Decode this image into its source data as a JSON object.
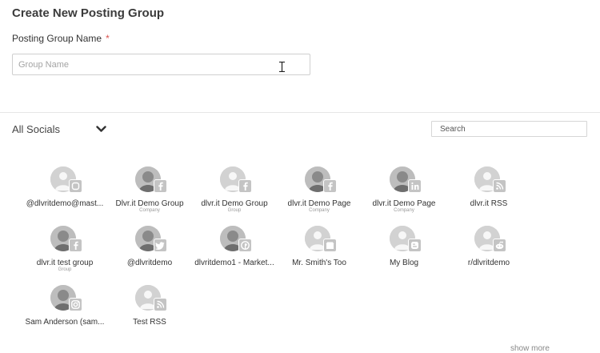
{
  "form": {
    "title": "Create New Posting Group",
    "group_name_label": "Posting Group Name",
    "required_mark": "*",
    "group_name_placeholder": "Group Name",
    "group_name_value": ""
  },
  "socials": {
    "filter_label": "All Socials",
    "search_placeholder": "Search",
    "show_more_label": "show more",
    "accounts": [
      {
        "name": "@dlvritdemo@mast...",
        "sub": "",
        "network": "mastodon-icon",
        "avatar": "default-avatar-icon"
      },
      {
        "name": "Dlvr.it Demo Group",
        "sub": "Company",
        "network": "facebook-icon",
        "avatar": "photo-avatar"
      },
      {
        "name": "dlvr.it Demo Group",
        "sub": "Group",
        "network": "facebook-icon",
        "avatar": "default-avatar-icon"
      },
      {
        "name": "dlvr.it Demo Page",
        "sub": "Company",
        "network": "facebook-icon",
        "avatar": "photo-avatar"
      },
      {
        "name": "dlvr.it Demo Page",
        "sub": "Company",
        "network": "linkedin-icon",
        "avatar": "photo-avatar"
      },
      {
        "name": "dlvr.it RSS",
        "sub": "",
        "network": "rss-icon",
        "avatar": "default-avatar-icon"
      },
      {
        "name": "dlvr.it test group",
        "sub": "Group",
        "network": "facebook-icon",
        "avatar": "photo-avatar"
      },
      {
        "name": "@dlvritdemo",
        "sub": "",
        "network": "twitter-icon",
        "avatar": "photo-avatar"
      },
      {
        "name": "dlvritdemo1 - Market...",
        "sub": "",
        "network": "pinterest-icon",
        "avatar": "photo-avatar"
      },
      {
        "name": "Mr. Smith's Too",
        "sub": "",
        "network": "google-business-icon",
        "avatar": "default-avatar-icon"
      },
      {
        "name": "My Blog",
        "sub": "",
        "network": "blogger-icon",
        "avatar": "default-avatar-icon"
      },
      {
        "name": "r/dlvritdemo",
        "sub": "",
        "network": "reddit-icon",
        "avatar": "default-avatar-icon"
      },
      {
        "name": "Sam Anderson (sam...",
        "sub": "",
        "network": "instagram-icon",
        "avatar": "photo-avatar"
      },
      {
        "name": "Test RSS",
        "sub": "",
        "network": "rss-icon",
        "avatar": "default-avatar-icon"
      }
    ]
  }
}
